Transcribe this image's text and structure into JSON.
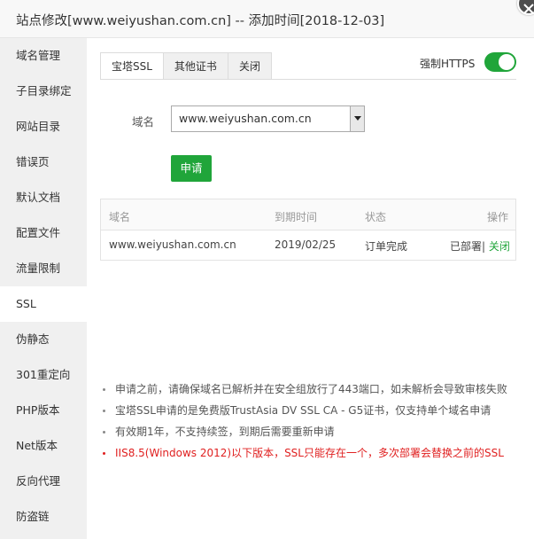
{
  "window": {
    "title": "站点修改[www.weiyushan.com.cn] -- 添加时间[2018-12-03]",
    "close_icon": "close-icon"
  },
  "sidebar": {
    "items": [
      {
        "label": "域名管理"
      },
      {
        "label": "子目录绑定"
      },
      {
        "label": "网站目录"
      },
      {
        "label": "错误页"
      },
      {
        "label": "默认文档"
      },
      {
        "label": "配置文件"
      },
      {
        "label": "流量限制"
      },
      {
        "label": "SSL",
        "active": true
      },
      {
        "label": "伪静态"
      },
      {
        "label": "301重定向"
      },
      {
        "label": "PHP版本"
      },
      {
        "label": "Net版本"
      },
      {
        "label": "反向代理"
      },
      {
        "label": "防盗链"
      }
    ]
  },
  "ssl": {
    "tabs": [
      "宝塔SSL",
      "其他证书",
      "关闭"
    ],
    "active_tab": "宝塔SSL",
    "force_https_label": "强制HTTPS",
    "force_https_enabled": true,
    "domain_label": "域名",
    "domain_selected": "www.weiyushan.com.cn",
    "apply_label": "申请",
    "table": {
      "headers": [
        "域名",
        "到期时间",
        "状态",
        "操作"
      ],
      "rows": [
        {
          "domain": "www.weiyushan.com.cn",
          "expire": "2019/02/25",
          "status": "订单完成",
          "deployed": "已部署",
          "separator": "|",
          "close": "关闭"
        }
      ]
    },
    "notes": [
      "申请之前，请确保域名已解析并在安全组放行了443端口，如未解析会导致审核失败",
      "宝塔SSL申请的是免费版TrustAsia DV SSL CA - G5证书，仅支持单个域名申请",
      "有效期1年，不支持续签，到期后需要重新申请",
      "IIS8.5(Windows 2012)以下版本，SSL只能存在一个，多次部署会替换之前的SSL"
    ]
  },
  "colors": {
    "accent": "#20a53a",
    "warning": "#e02020",
    "sidebar_bg": "#f0f0f0"
  }
}
